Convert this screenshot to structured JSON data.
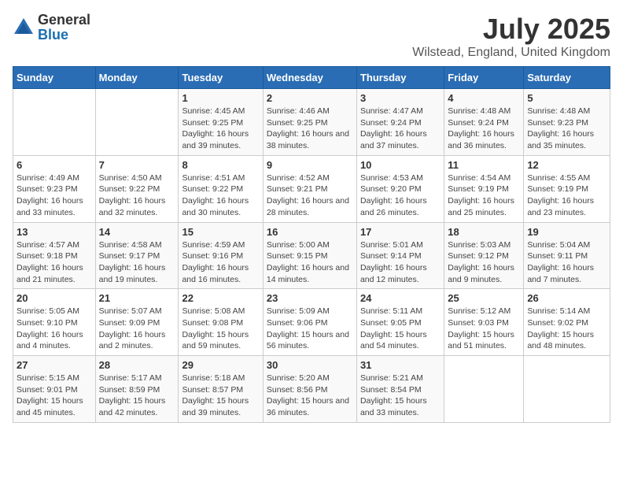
{
  "logo": {
    "general": "General",
    "blue": "Blue"
  },
  "header": {
    "title": "July 2025",
    "subtitle": "Wilstead, England, United Kingdom"
  },
  "weekdays": [
    "Sunday",
    "Monday",
    "Tuesday",
    "Wednesday",
    "Thursday",
    "Friday",
    "Saturday"
  ],
  "weeks": [
    [
      {
        "day": "",
        "details": ""
      },
      {
        "day": "",
        "details": ""
      },
      {
        "day": "1",
        "details": "Sunrise: 4:45 AM\nSunset: 9:25 PM\nDaylight: 16 hours and 39 minutes."
      },
      {
        "day": "2",
        "details": "Sunrise: 4:46 AM\nSunset: 9:25 PM\nDaylight: 16 hours and 38 minutes."
      },
      {
        "day": "3",
        "details": "Sunrise: 4:47 AM\nSunset: 9:24 PM\nDaylight: 16 hours and 37 minutes."
      },
      {
        "day": "4",
        "details": "Sunrise: 4:48 AM\nSunset: 9:24 PM\nDaylight: 16 hours and 36 minutes."
      },
      {
        "day": "5",
        "details": "Sunrise: 4:48 AM\nSunset: 9:23 PM\nDaylight: 16 hours and 35 minutes."
      }
    ],
    [
      {
        "day": "6",
        "details": "Sunrise: 4:49 AM\nSunset: 9:23 PM\nDaylight: 16 hours and 33 minutes."
      },
      {
        "day": "7",
        "details": "Sunrise: 4:50 AM\nSunset: 9:22 PM\nDaylight: 16 hours and 32 minutes."
      },
      {
        "day": "8",
        "details": "Sunrise: 4:51 AM\nSunset: 9:22 PM\nDaylight: 16 hours and 30 minutes."
      },
      {
        "day": "9",
        "details": "Sunrise: 4:52 AM\nSunset: 9:21 PM\nDaylight: 16 hours and 28 minutes."
      },
      {
        "day": "10",
        "details": "Sunrise: 4:53 AM\nSunset: 9:20 PM\nDaylight: 16 hours and 26 minutes."
      },
      {
        "day": "11",
        "details": "Sunrise: 4:54 AM\nSunset: 9:19 PM\nDaylight: 16 hours and 25 minutes."
      },
      {
        "day": "12",
        "details": "Sunrise: 4:55 AM\nSunset: 9:19 PM\nDaylight: 16 hours and 23 minutes."
      }
    ],
    [
      {
        "day": "13",
        "details": "Sunrise: 4:57 AM\nSunset: 9:18 PM\nDaylight: 16 hours and 21 minutes."
      },
      {
        "day": "14",
        "details": "Sunrise: 4:58 AM\nSunset: 9:17 PM\nDaylight: 16 hours and 19 minutes."
      },
      {
        "day": "15",
        "details": "Sunrise: 4:59 AM\nSunset: 9:16 PM\nDaylight: 16 hours and 16 minutes."
      },
      {
        "day": "16",
        "details": "Sunrise: 5:00 AM\nSunset: 9:15 PM\nDaylight: 16 hours and 14 minutes."
      },
      {
        "day": "17",
        "details": "Sunrise: 5:01 AM\nSunset: 9:14 PM\nDaylight: 16 hours and 12 minutes."
      },
      {
        "day": "18",
        "details": "Sunrise: 5:03 AM\nSunset: 9:12 PM\nDaylight: 16 hours and 9 minutes."
      },
      {
        "day": "19",
        "details": "Sunrise: 5:04 AM\nSunset: 9:11 PM\nDaylight: 16 hours and 7 minutes."
      }
    ],
    [
      {
        "day": "20",
        "details": "Sunrise: 5:05 AM\nSunset: 9:10 PM\nDaylight: 16 hours and 4 minutes."
      },
      {
        "day": "21",
        "details": "Sunrise: 5:07 AM\nSunset: 9:09 PM\nDaylight: 16 hours and 2 minutes."
      },
      {
        "day": "22",
        "details": "Sunrise: 5:08 AM\nSunset: 9:08 PM\nDaylight: 15 hours and 59 minutes."
      },
      {
        "day": "23",
        "details": "Sunrise: 5:09 AM\nSunset: 9:06 PM\nDaylight: 15 hours and 56 minutes."
      },
      {
        "day": "24",
        "details": "Sunrise: 5:11 AM\nSunset: 9:05 PM\nDaylight: 15 hours and 54 minutes."
      },
      {
        "day": "25",
        "details": "Sunrise: 5:12 AM\nSunset: 9:03 PM\nDaylight: 15 hours and 51 minutes."
      },
      {
        "day": "26",
        "details": "Sunrise: 5:14 AM\nSunset: 9:02 PM\nDaylight: 15 hours and 48 minutes."
      }
    ],
    [
      {
        "day": "27",
        "details": "Sunrise: 5:15 AM\nSunset: 9:01 PM\nDaylight: 15 hours and 45 minutes."
      },
      {
        "day": "28",
        "details": "Sunrise: 5:17 AM\nSunset: 8:59 PM\nDaylight: 15 hours and 42 minutes."
      },
      {
        "day": "29",
        "details": "Sunrise: 5:18 AM\nSunset: 8:57 PM\nDaylight: 15 hours and 39 minutes."
      },
      {
        "day": "30",
        "details": "Sunrise: 5:20 AM\nSunset: 8:56 PM\nDaylight: 15 hours and 36 minutes."
      },
      {
        "day": "31",
        "details": "Sunrise: 5:21 AM\nSunset: 8:54 PM\nDaylight: 15 hours and 33 minutes."
      },
      {
        "day": "",
        "details": ""
      },
      {
        "day": "",
        "details": ""
      }
    ]
  ]
}
